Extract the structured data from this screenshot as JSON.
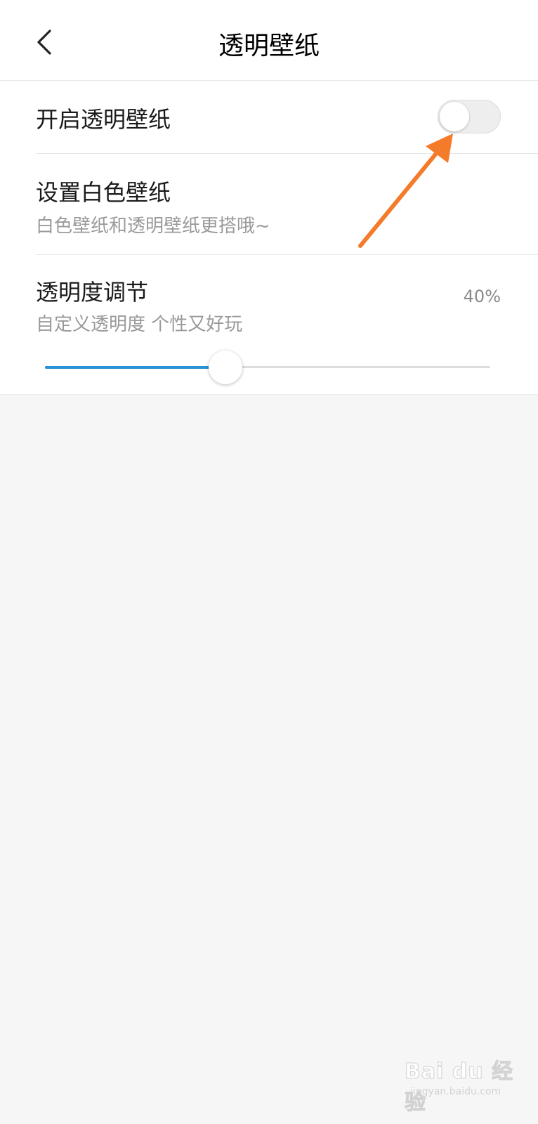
{
  "header": {
    "title": "透明壁纸",
    "back_icon": "chevron-left-icon"
  },
  "settings": {
    "enable_transparent": {
      "label": "开启透明壁纸",
      "enabled": false
    },
    "white_wallpaper": {
      "label": "设置白色壁纸",
      "subtitle": "白色壁纸和透明壁纸更搭哦~"
    },
    "transparency": {
      "label": "透明度调节",
      "subtitle": "自定义透明度 个性又好玩",
      "value_text": "40%",
      "value": 0.4
    }
  },
  "colors": {
    "slider_fill": "#2a93d5",
    "annotation_arrow": "#f47b2a"
  },
  "watermark": {
    "text": "Bai du 经验",
    "sub": "jingyan.baidu.com"
  }
}
